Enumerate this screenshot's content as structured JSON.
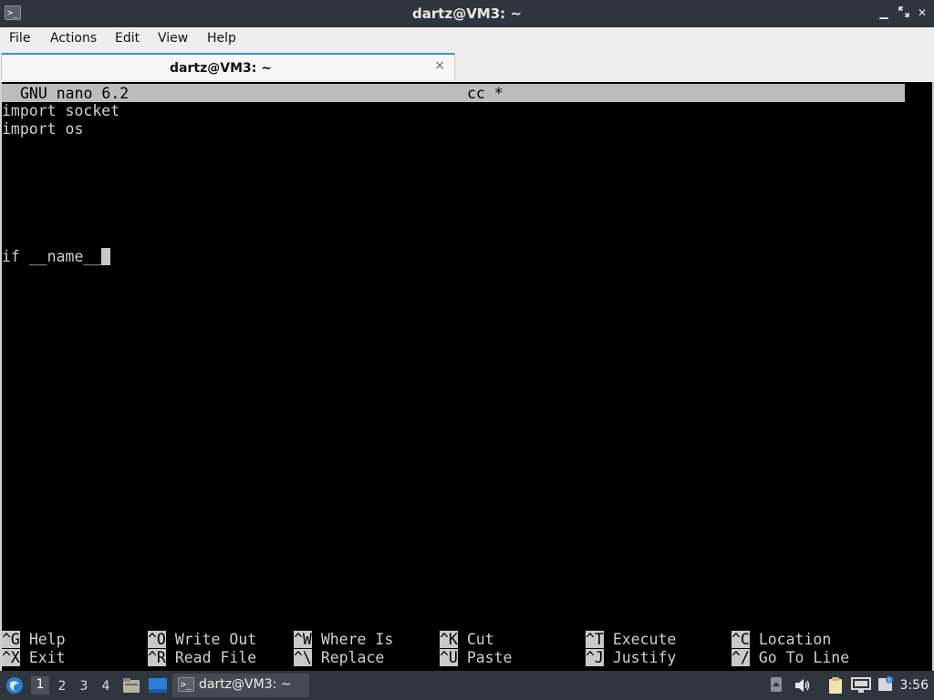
{
  "window": {
    "title": "dartz@VM3: ~",
    "icon_text": ">_",
    "controls": [
      "minimize",
      "maximize",
      "close"
    ]
  },
  "menubar": {
    "items": [
      "File",
      "Actions",
      "Edit",
      "View",
      "Help"
    ]
  },
  "tab": {
    "label": "dartz@VM3: ~",
    "close_glyph": "×"
  },
  "nano": {
    "version": "GNU nano 6.2",
    "filename": "cc *",
    "lines": [
      "import socket",
      "import os",
      "",
      "",
      "",
      "",
      "",
      "if __name__"
    ],
    "shortcuts_row1": [
      {
        "key": "^G",
        "label": "Help"
      },
      {
        "key": "^O",
        "label": "Write Out"
      },
      {
        "key": "^W",
        "label": "Where Is"
      },
      {
        "key": "^K",
        "label": "Cut"
      },
      {
        "key": "^T",
        "label": "Execute"
      },
      {
        "key": "^C",
        "label": "Location"
      }
    ],
    "shortcuts_row2": [
      {
        "key": "^X",
        "label": "Exit"
      },
      {
        "key": "^R",
        "label": "Read File"
      },
      {
        "key": "^\\",
        "label": "Replace"
      },
      {
        "key": "^U",
        "label": "Paste"
      },
      {
        "key": "^J",
        "label": "Justify"
      },
      {
        "key": "^/",
        "label": "Go To Line"
      }
    ]
  },
  "taskbar": {
    "workspaces": [
      "1",
      "2",
      "3",
      "4"
    ],
    "active_workspace": "1",
    "task_label": "dartz@VM3: ~",
    "clock": "3:56",
    "tray_icons": [
      "scroll-up-icon",
      "volume-icon",
      "clipboard-icon",
      "network-icon",
      "notification-icon"
    ]
  },
  "colors": {
    "accent": "#3d8ee0",
    "terminal_bg": "#000000",
    "nano_bar": "#bcbcbc"
  }
}
